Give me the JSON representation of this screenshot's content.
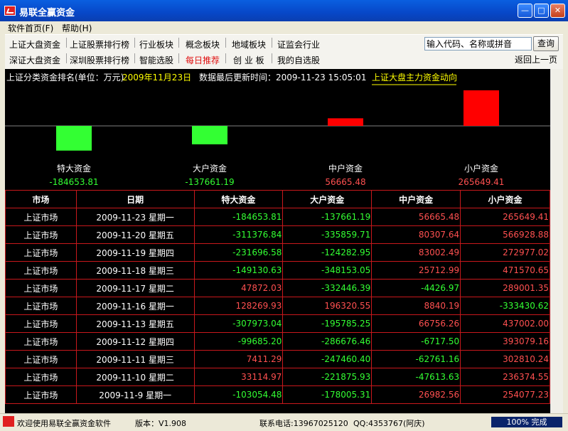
{
  "window": {
    "title": "易联全赢资金"
  },
  "menu": [
    {
      "label": "软件首页(F)"
    },
    {
      "label": "帮助(H)"
    }
  ],
  "nav": {
    "row1": [
      {
        "label": "上证大盘资金"
      },
      {
        "label": "上证股票排行榜"
      },
      {
        "label": "行业板块"
      },
      {
        "label": "概念板块"
      },
      {
        "label": "地域板块"
      },
      {
        "label": "证监会行业"
      }
    ],
    "row2": [
      {
        "label": "深证大盘资金"
      },
      {
        "label": "深圳股票排行榜"
      },
      {
        "label": "智能选股"
      },
      {
        "label": "每日推荐"
      },
      {
        "label": "创 业 板"
      },
      {
        "label": "我的自选股"
      }
    ],
    "search_value": "输入代码、名称或拼音",
    "search_label": "查询",
    "back_label": "返回上一页"
  },
  "header": {
    "label": "上证分类资金排名(单位：万元)",
    "date": "2009年11月23日",
    "update": "数据最后更新时间：2009-11-23 15:05:01",
    "link": "上证大盘主力资金动向"
  },
  "chart_data": {
    "type": "bar",
    "categories": [
      "特大资金",
      "大户资金",
      "中户资金",
      "小户资金"
    ],
    "values": [
      -184653.81,
      -137661.19,
      56665.48,
      265649.41
    ],
    "value_labels": [
      "-184653.81",
      "-137661.19",
      "56665.48",
      "265649.41"
    ],
    "ylim": [
      -265649.41,
      265649.41
    ],
    "colors": {
      "positive": "#FF0000",
      "negative": "#33FF33"
    }
  },
  "table": {
    "headers": [
      "市场",
      "日期",
      "特大资金",
      "大户资金",
      "中户资金",
      "小户资金"
    ],
    "rows": [
      [
        "上证市场",
        "2009-11-23 星期一",
        "-184653.81",
        "-137661.19",
        "56665.48",
        "265649.41"
      ],
      [
        "上证市场",
        "2009-11-20 星期五",
        "-311376.84",
        "-335859.71",
        "80307.64",
        "566928.88"
      ],
      [
        "上证市场",
        "2009-11-19 星期四",
        "-231696.58",
        "-124282.95",
        "83002.49",
        "272977.02"
      ],
      [
        "上证市场",
        "2009-11-18 星期三",
        "-149130.63",
        "-348153.05",
        "25712.99",
        "471570.65"
      ],
      [
        "上证市场",
        "2009-11-17 星期二",
        "47872.03",
        "-332446.39",
        "-4426.97",
        "289001.35"
      ],
      [
        "上证市场",
        "2009-11-16 星期一",
        "128269.93",
        "196320.55",
        "8840.19",
        "-333430.62"
      ],
      [
        "上证市场",
        "2009-11-13 星期五",
        "-307973.04",
        "-195785.25",
        "66756.26",
        "437002.00"
      ],
      [
        "上证市场",
        "2009-11-12 星期四",
        "-99685.20",
        "-286676.46",
        "-6717.50",
        "393079.16"
      ],
      [
        "上证市场",
        "2009-11-11 星期三",
        "7411.29",
        "-247460.40",
        "-62761.16",
        "302810.24"
      ],
      [
        "上证市场",
        "2009-11-10 星期二",
        "33114.97",
        "-221875.93",
        "-47613.63",
        "236374.55"
      ],
      [
        "上证市场",
        "2009-11-9 星期一",
        "-103054.48",
        "-178005.31",
        "26982.56",
        "254077.23"
      ]
    ],
    "colors": {
      "positive": "#FF5050",
      "negative": "#33FF33",
      "border": "#C8181C"
    }
  },
  "status": {
    "welcome": "欢迎使用易联全赢资金软件",
    "version": "版本：V1.908",
    "phone": "联系电话:13967025120",
    "qq": "QQ:4353767(阿庆)",
    "progress": 100,
    "progress_text": "100% 完成"
  },
  "icons": [
    "app-logo-icon",
    "minimize-icon",
    "maximize-icon",
    "close-icon"
  ]
}
